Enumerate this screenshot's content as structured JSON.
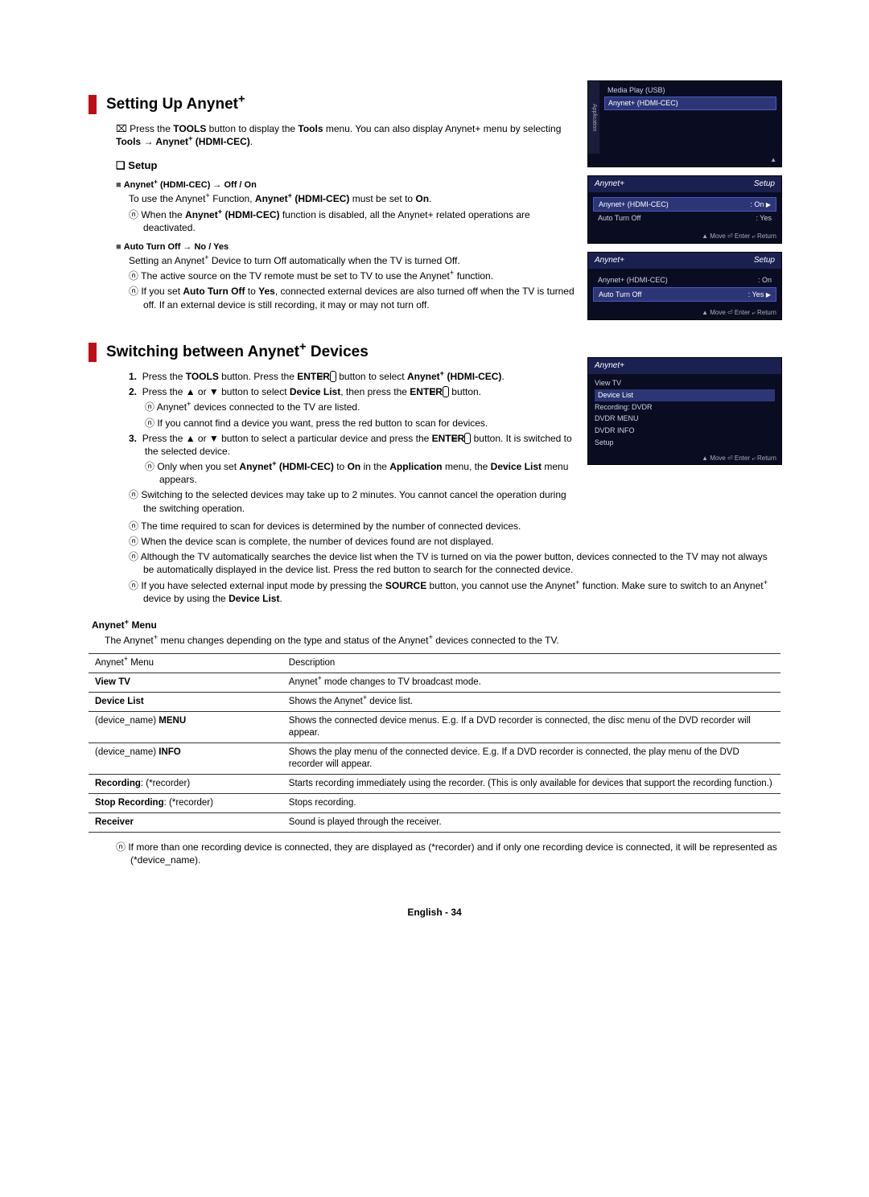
{
  "section1": {
    "title_pre": "Setting Up Anynet",
    "title_sup": "+",
    "intro_a": "Press the ",
    "intro_b": "TOOLS",
    "intro_c": " button to display the ",
    "intro_d": "Tools",
    "intro_e": " menu. You can also display Anynet+ menu by selecting ",
    "intro_f": "Tools → Anynet",
    "intro_g": " (HDMI-CEC)",
    "intro_h": ".",
    "setup_heading": "Setup",
    "item1_heading_pre": "Anynet",
    "item1_heading_post": " (HDMI-CEC) → Off / On",
    "item1_p1_a": "To use the Anynet",
    "item1_p1_b": " Function, ",
    "item1_p1_c": "Anynet",
    "item1_p1_d": " (HDMI-CEC)",
    "item1_p1_e": " must be set to ",
    "item1_p1_f": "On",
    "item1_p1_g": ".",
    "item1_n1_a": "When the ",
    "item1_n1_b": "Anynet",
    "item1_n1_c": " (HDMI-CEC)",
    "item1_n1_d": " function is disabled, all the Anynet+ related operations are deactivated.",
    "item2_heading": "Auto Turn Off → No / Yes",
    "item2_p1": "Setting an Anynet+ Device to turn Off automatically when the TV is turned Off.",
    "item2_n1": "The active source on the TV remote must be set to TV to use the Anynet+ function.",
    "item2_n2_a": "If you set ",
    "item2_n2_b": "Auto Turn Off",
    "item2_n2_c": " to ",
    "item2_n2_d": "Yes",
    "item2_n2_e": ", connected external devices are also turned off when the TV is turned off. If an external device is still recording, it may or may not turn off."
  },
  "section2": {
    "title_pre": "Switching between Anynet",
    "title_sup": "+",
    "title_post": " Devices",
    "s1_a": "Press the ",
    "s1_b": "TOOLS",
    "s1_c": " button. Press the ",
    "s1_d": "ENTER",
    "s1_e": " button to select ",
    "s1_f": "Anynet",
    "s1_g": " (HDMI-CEC)",
    "s1_h": ".",
    "s2_a": "Press the ▲ or ▼ button to select ",
    "s2_b": "Device List",
    "s2_c": ", then press the ",
    "s2_d": "ENTER",
    "s2_e": " button.",
    "s2_n1": "Anynet+ devices connected to the TV are listed.",
    "s2_n2": "If you cannot find a device you want, press the red button to scan for devices.",
    "s3_a": "Press the ▲ or ▼ button to select a particular device and press the ",
    "s3_b": "ENTER",
    "s3_c": " button. It is switched to the selected device.",
    "s3_n1_a": "Only when you set ",
    "s3_n1_b": "Anynet",
    "s3_n1_c": " (HDMI-CEC)",
    "s3_n1_d": " to ",
    "s3_n1_e": "On",
    "s3_n1_f": " in the ",
    "s3_n1_g": "Application",
    "s3_n1_h": " menu, the ",
    "s3_n1_i": "Device List",
    "s3_n1_j": " menu appears.",
    "n4": "Switching to the selected devices may take up to 2 minutes. You cannot cancel the operation during the switching operation.",
    "n5": "The time required to scan for devices is determined by the number of connected devices.",
    "n6": "When the device scan is complete, the number of devices found are not displayed.",
    "n7": "Although the TV automatically searches the device list when the TV is turned on via the power button, devices connected to the TV may not always be automatically displayed in the device list. Press the red button to search for the connected device.",
    "n8_a": "If you have selected external input mode by pressing the ",
    "n8_b": "SOURCE",
    "n8_c": " button, you cannot use the Anynet",
    "n8_d": " function. Make sure to switch to an Anynet",
    "n8_e": " device by using the ",
    "n8_f": "Device List",
    "n8_g": "."
  },
  "menu": {
    "heading_pre": "Anynet",
    "heading_post": " Menu",
    "intro_a": "The Anynet",
    "intro_b": " menu changes depending on the type and status of the Anynet",
    "intro_c": " devices connected to the TV.",
    "col1": "Anynet+ Menu",
    "col2": "Description",
    "rows": [
      {
        "c1": "View TV",
        "bold1": true,
        "c2_a": "Anynet",
        "c2_b": " mode changes to TV broadcast mode."
      },
      {
        "c1": "Device List",
        "bold1": true,
        "c2_a": "Shows the Anynet",
        "c2_b": " device list."
      },
      {
        "c1_a": "(device_name) ",
        "c1_b": "MENU",
        "c2": "Shows the connected device menus. E.g. If a DVD recorder is connected, the disc menu of the DVD recorder will appear."
      },
      {
        "c1_a": "(device_name) ",
        "c1_b": "INFO",
        "c2": "Shows the play menu of the connected device. E.g. If a DVD recorder is connected, the play menu of the DVD recorder will appear."
      },
      {
        "c1_a": "Recording",
        "c1_bold_a": true,
        "c1_b": ": (*recorder)",
        "c2": "Starts recording immediately using the recorder. (This is only available for devices that support the recording function.)"
      },
      {
        "c1_a": "Stop Recording",
        "c1_bold_a": true,
        "c1_b": ": (*recorder)",
        "c2": "Stops recording."
      },
      {
        "c1": "Receiver",
        "bold1": true,
        "c2": "Sound is played through the receiver."
      }
    ],
    "foot": "If more than one recording device is connected, they are displayed as (*recorder) and if only one recording device is connected, it will be represented as (*device_name)."
  },
  "screens": {
    "s1": {
      "leftlabel": "Application",
      "row1": "Media Play (USB)",
      "row2": "Anynet+ (HDMI-CEC)",
      "footer": "▲"
    },
    "s2": {
      "header_l": "Anynet+",
      "header_r": "Setup",
      "line1_l": "Anynet+ (HDMI-CEC)",
      "line1_r": ": On",
      "line2_l": "Auto Turn Off",
      "line2_r": ": Yes",
      "footer": "▲ Move   ⏎ Enter   ⤶ Return"
    },
    "s3": {
      "header_l": "Anynet+",
      "header_r": "Setup",
      "line1_l": "Anynet+ (HDMI-CEC)",
      "line1_r": ": On",
      "line2_l": "Auto Turn Off",
      "line2_r": ": Yes",
      "footer": "▲ Move   ⏎ Enter   ⤶ Return"
    },
    "s4": {
      "header_l": "Anynet+",
      "items": [
        "View TV",
        "Device List",
        "Recording: DVDR",
        "DVDR MENU",
        "DVDR INFO",
        "Setup"
      ],
      "footer": "▲ Move   ⏎ Enter   ⤶ Return"
    }
  },
  "page_num": "English - 34"
}
